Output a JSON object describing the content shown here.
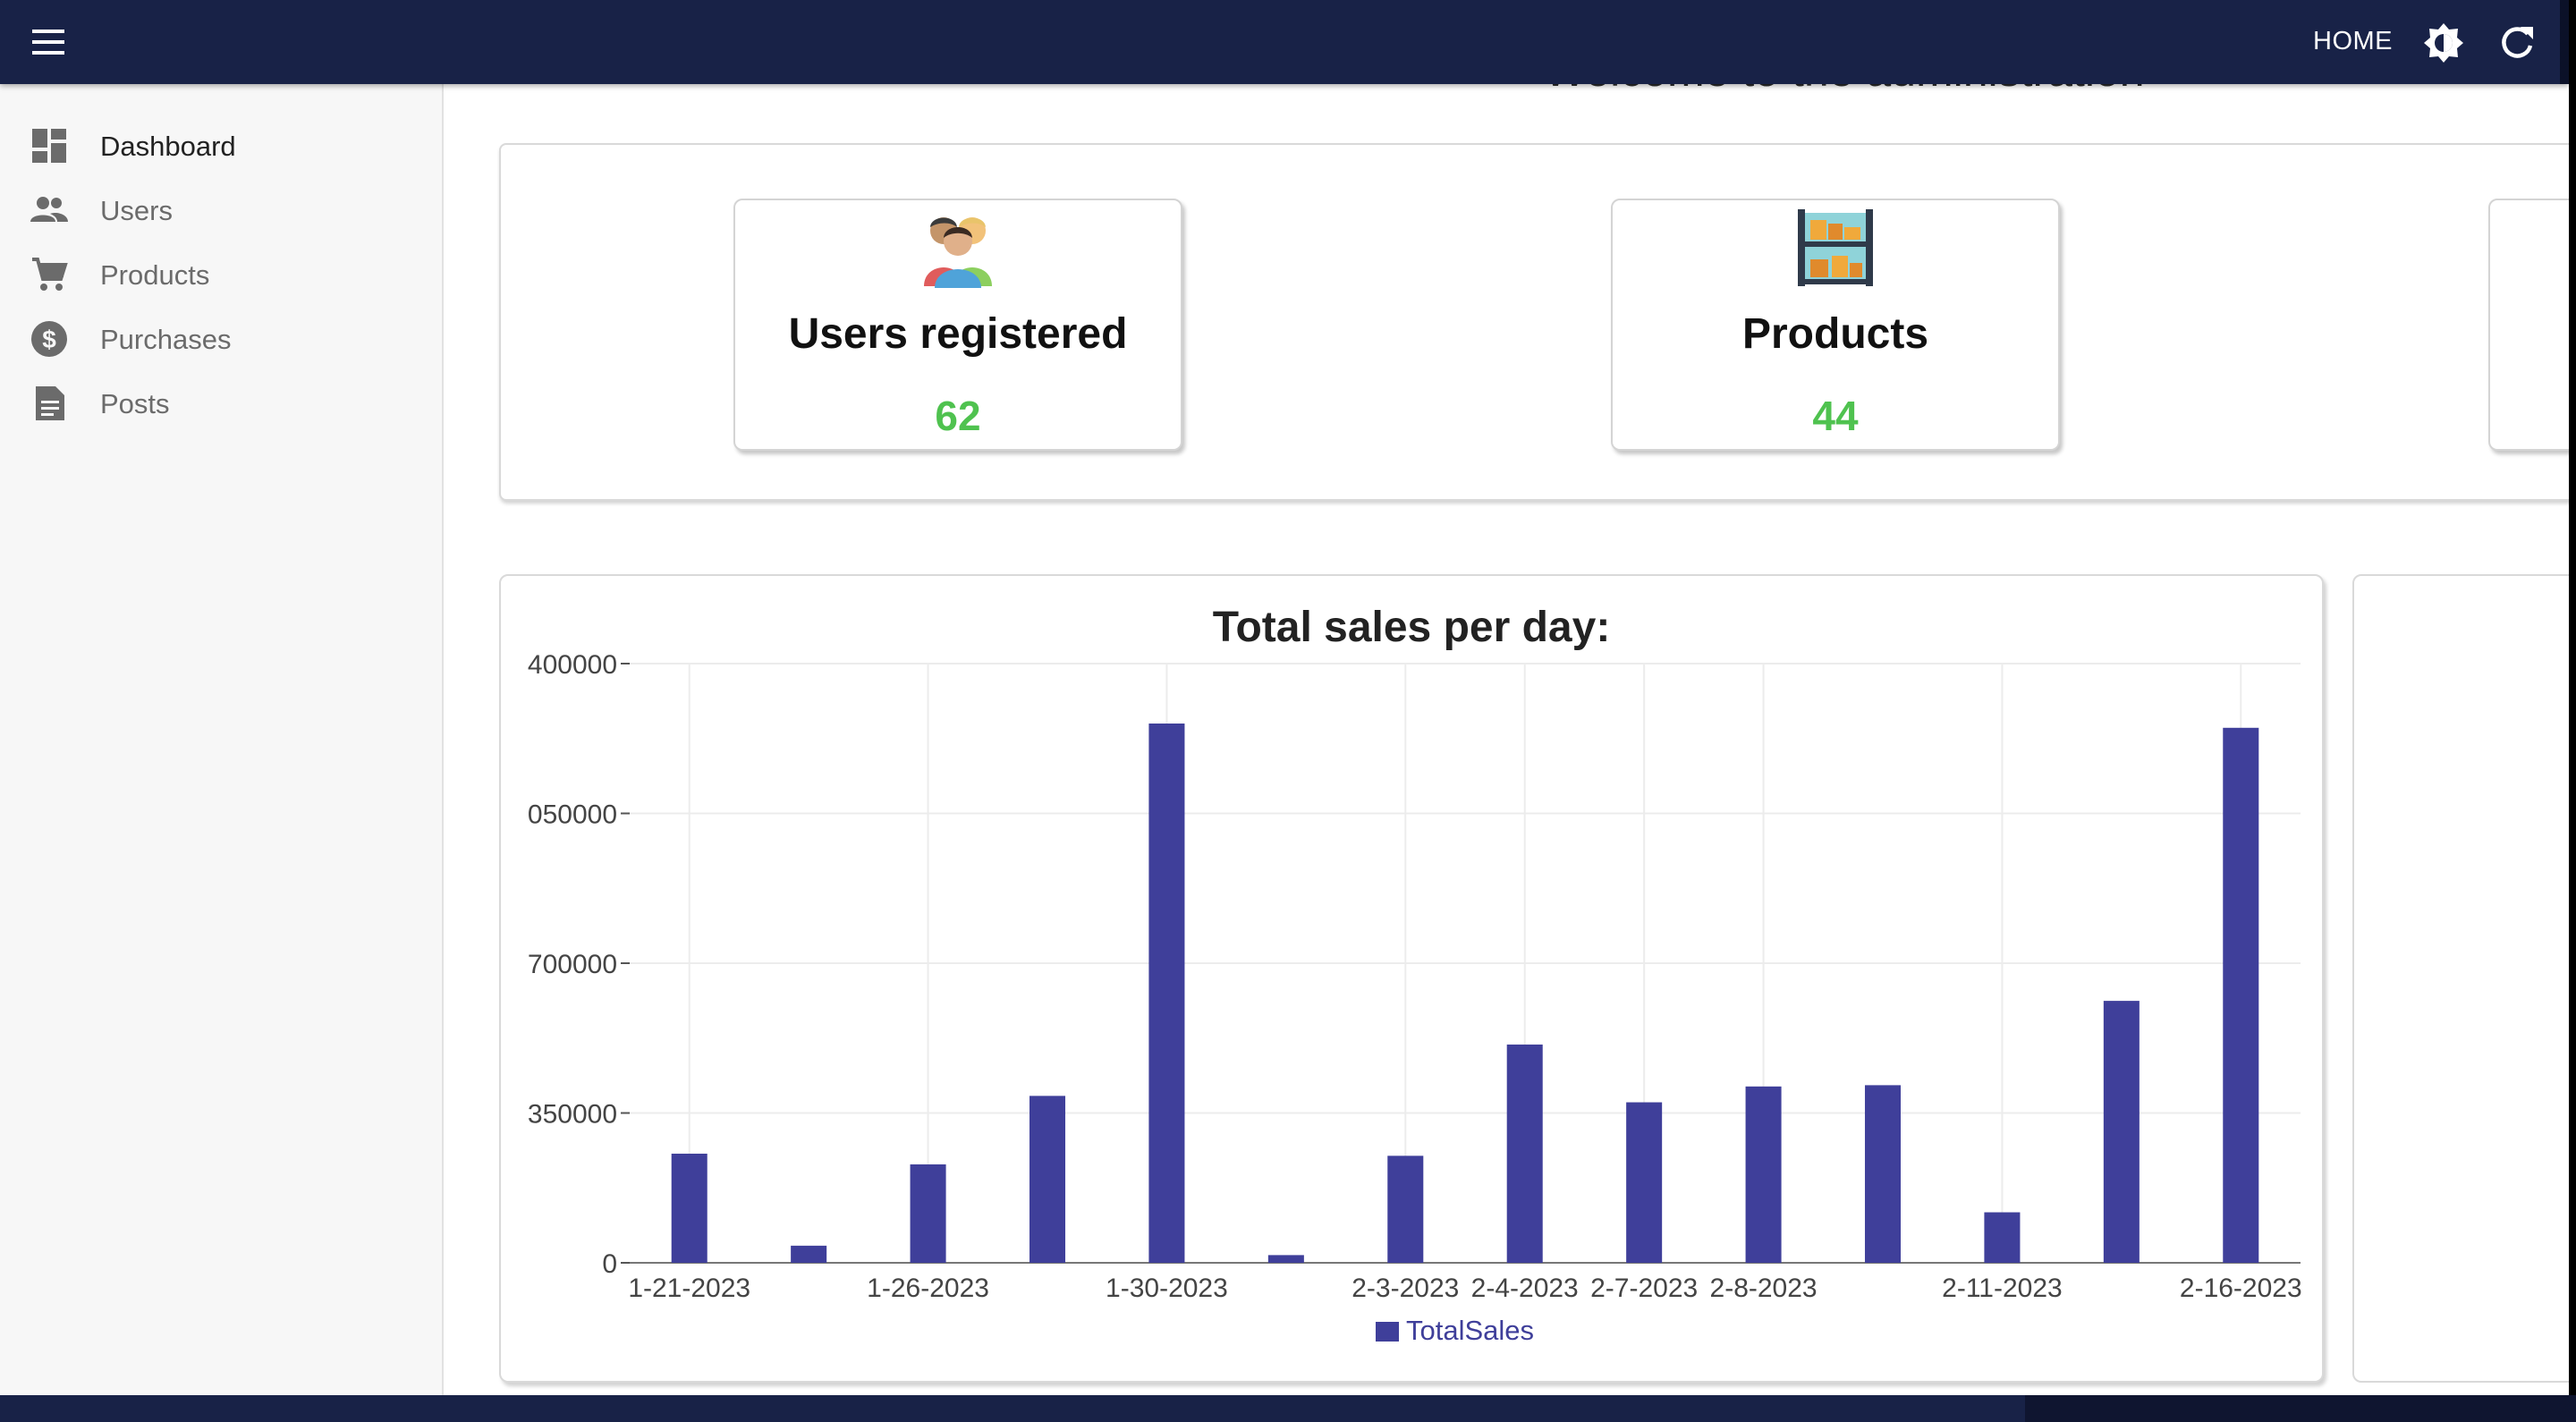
{
  "header": {
    "home_label": "HOME",
    "icons": [
      "menu-icon",
      "brightness-icon",
      "refresh-icon"
    ]
  },
  "sidebar": {
    "items": [
      {
        "label": "Dashboard",
        "icon": "dashboard-icon",
        "active": true
      },
      {
        "label": "Users",
        "icon": "people-icon",
        "active": false
      },
      {
        "label": "Products",
        "icon": "cart-icon",
        "active": false
      },
      {
        "label": "Purchases",
        "icon": "dollar-icon",
        "active": false
      },
      {
        "label": "Posts",
        "icon": "document-icon",
        "active": false
      }
    ]
  },
  "main": {
    "welcome": "Welcome to the administration",
    "stats": [
      {
        "title": "Users registered",
        "value": "62",
        "icon": "users-group-icon"
      },
      {
        "title": "Products",
        "value": "44",
        "icon": "shelves-icon"
      }
    ]
  },
  "colors": {
    "appbar": "#182247",
    "bar": "#3f3f9a",
    "stat_value": "#4fc24f",
    "sidebar_bg": "#f7f7f7"
  },
  "chart_data": {
    "type": "bar",
    "title": "Total sales per day:",
    "xlabel": "",
    "ylabel": "",
    "y_tick_labels": [
      "0",
      "350000",
      "700000",
      "050000",
      "400000"
    ],
    "ylim": [
      0,
      1400000
    ],
    "x_tick_labels": [
      "1-21-2023",
      "1-26-2023",
      "1-30-2023",
      "2-3-2023",
      "2-4-2023",
      "2-7-2023",
      "2-8-2023",
      "2-11-2023",
      "2-16-2023"
    ],
    "categories": [
      "1-21-2023",
      "",
      "1-26-2023",
      "",
      "1-30-2023",
      "",
      "2-3-2023",
      "2-4-2023",
      "2-7-2023",
      "2-8-2023",
      "",
      "2-11-2023",
      "",
      "2-16-2023"
    ],
    "series": [
      {
        "name": "TotalSales",
        "values": [
          255000,
          40000,
          230000,
          390000,
          1260000,
          18000,
          250000,
          510000,
          375000,
          412000,
          415000,
          118000,
          612000,
          1250000
        ]
      }
    ],
    "legend": "bottom",
    "grid": true
  }
}
